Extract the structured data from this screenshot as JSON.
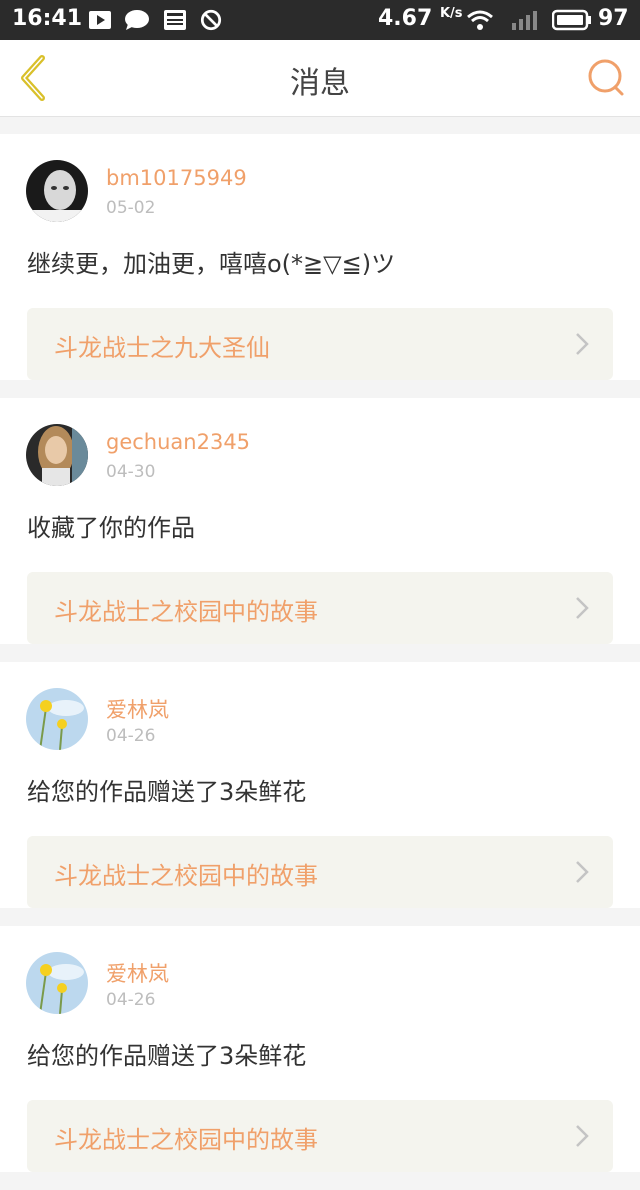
{
  "status_bar": {
    "time": "16:41",
    "speed": "4.67",
    "speed_unit": "K/s",
    "battery": "97"
  },
  "header": {
    "title": "消息"
  },
  "messages": [
    {
      "username": "bm10175949",
      "date": "05-02",
      "text": "继续更，加油更，嘻嘻o(*≧▽≦)ツ",
      "work_title": "斗龙战士之九大圣仙",
      "avatar": "bw-avatar"
    },
    {
      "username": "gechuan2345",
      "date": "04-30",
      "text": "收藏了你的作品",
      "work_title": "斗龙战士之校园中的故事",
      "avatar": "portrait-avatar"
    },
    {
      "username": "爱林岚",
      "date": "04-26",
      "text": "给您的作品赠送了3朵鲜花",
      "work_title": "斗龙战士之校园中的故事",
      "avatar": "flower-avatar"
    },
    {
      "username": "爱林岚",
      "date": "04-26",
      "text": "给您的作品赠送了3朵鲜花",
      "work_title": "斗龙战士之校园中的故事",
      "avatar": "flower-avatar"
    }
  ],
  "colors": {
    "accent": "#f0a06a",
    "back_icon": "#d9c02a",
    "card_bg": "#ffffff",
    "work_bg": "#f4f4ee"
  }
}
